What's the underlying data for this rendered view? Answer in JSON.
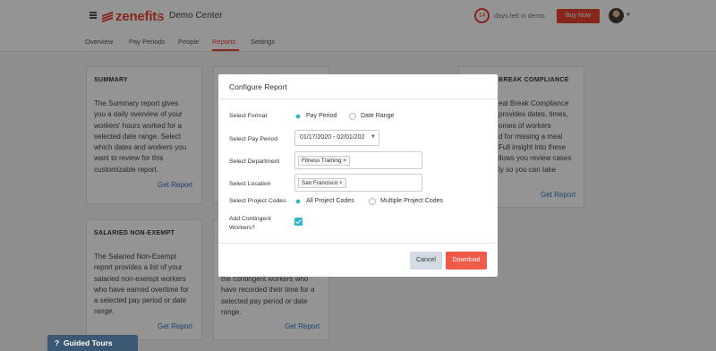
{
  "header": {
    "brand": "zenefits",
    "workspace": "Demo Center",
    "days_left": "14",
    "days_left_text": "days left in demo",
    "buy_now": "Buy Now"
  },
  "tabs": [
    {
      "label": "Overview"
    },
    {
      "label": "Pay Periods"
    },
    {
      "label": "People"
    },
    {
      "label": "Reports",
      "active": true
    },
    {
      "label": "Settings"
    }
  ],
  "cards": {
    "summary": {
      "title": "SUMMARY",
      "lines": [
        "The Summary report gives",
        "you a daily overview of your",
        "workers' hours worked for a",
        "selected date range. Select",
        "which dates and workers you",
        "want to review for this",
        "customizable report."
      ],
      "link": "Get Report"
    },
    "salaried": {
      "title": "SALARIED NON-EXEMPT",
      "lines": [
        "The Salaried Non-Exempt",
        "report provides a list of your",
        "salaried non-exempt workers",
        "who have earned overtime for",
        "a selected pay period or date",
        "range."
      ],
      "link": "Get Report"
    },
    "contingent": {
      "lines": [
        "the contingent workers who",
        "have recorded their time for a",
        "selected pay period or date",
        "range."
      ],
      "link": "Get Report"
    },
    "meal_break": {
      "title": "BREAK COMPLIANCE",
      "lines": [
        "eal Break Compliance",
        "provides dates, times,",
        "omes of workers",
        "d for missing a meal",
        "Full insight into these",
        "llows you review cases",
        "ly so you can take"
      ],
      "link": "Get Report"
    }
  },
  "guided_tours": "Guided Tours",
  "modal": {
    "title": "Configure Report",
    "format_label": "Select Format",
    "format_options": [
      "Pay Period",
      "Date Range"
    ],
    "pay_period_label": "Select Pay Period",
    "pay_period_value": "01/17/2020 - 02/01/202",
    "department_label": "Select Department",
    "department_tag": "Fitness Training",
    "location_label": "Select Location",
    "location_tag": "San Francisco",
    "project_label": "Select Project Codes",
    "project_options": [
      "All Project Codes",
      "Multiple Project Codes"
    ],
    "contingent_label_1": "Add Contingent",
    "contingent_label_2": "Workers?",
    "cancel": "Cancel",
    "download": "Download"
  },
  "colors": {
    "brand": "#e8422f",
    "accent": "#2fb6c9",
    "download": "#f05a4a",
    "link": "#2a74b8"
  }
}
